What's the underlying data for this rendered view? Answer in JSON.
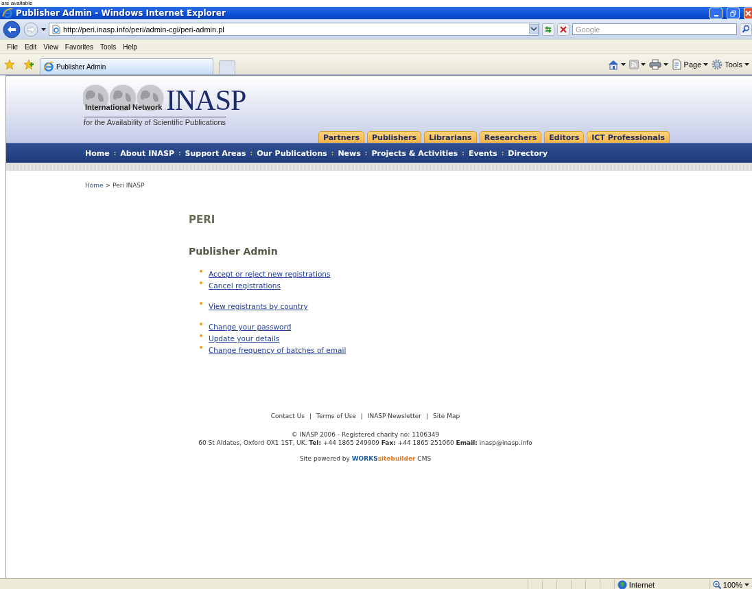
{
  "caption_fragment": "are available",
  "window": {
    "title": "Publisher Admin - Windows Internet Explorer"
  },
  "address_bar": {
    "url": "http://peri.inasp.info/peri/admin-cgi/peri-admin.pl"
  },
  "search": {
    "placeholder": "Google"
  },
  "menu": [
    "File",
    "Edit",
    "View",
    "Favorites",
    "Tools",
    "Help"
  ],
  "tabs": [
    {
      "label": "Publisher Admin",
      "selected": true
    }
  ],
  "command_bar": [
    {
      "kind": "home"
    },
    {
      "kind": "feeds"
    },
    {
      "kind": "print"
    },
    {
      "kind": "page",
      "label": "Page"
    },
    {
      "kind": "tools",
      "label": "Tools"
    }
  ],
  "site": {
    "logo": {
      "abbr": "INASP",
      "line1": "International Network",
      "line2": "for the Availability of Scientific Publications"
    },
    "audience_tabs": [
      "Partners",
      "Publishers",
      "Librarians",
      "Researchers",
      "Editors",
      "ICT Professionals"
    ],
    "nav_separator": ":",
    "nav": [
      "Home",
      "About INASP",
      "Support Areas",
      "Our Publications",
      "News",
      "Projects & Activities",
      "Events",
      "Directory"
    ],
    "breadcrumb": {
      "links": [
        "Home"
      ],
      "separator": ">",
      "current": "Peri INASP"
    },
    "heading": "PERI",
    "subheading": "Publisher Admin",
    "link_groups": [
      [
        "Accept or reject new registrations",
        "Cancel registrations"
      ],
      [
        "View registrants by country"
      ],
      [
        "Change your password",
        "Update your details",
        "Change frequency of batches of email"
      ]
    ],
    "footer": {
      "links": [
        "Contact Us",
        "Terms of Use",
        "INASP Newsletter",
        "Site Map"
      ],
      "separator": "|",
      "copyright": "© INASP 2006 - Registered charity no: 1106349",
      "address": "60 St Aldates, Oxford OX1 1ST, UK. **Tel:** +44 1865 249909 **Fax:** +44 1865 251060 **Email:** inasp@inasp.info",
      "powered": {
        "prefix": "Site powered by",
        "brand_a": "WORKS",
        "brand_b": "sitebuilder",
        "suffix": "CMS"
      }
    }
  },
  "status_bar": {
    "zone": "Internet",
    "zoom": "100%"
  }
}
